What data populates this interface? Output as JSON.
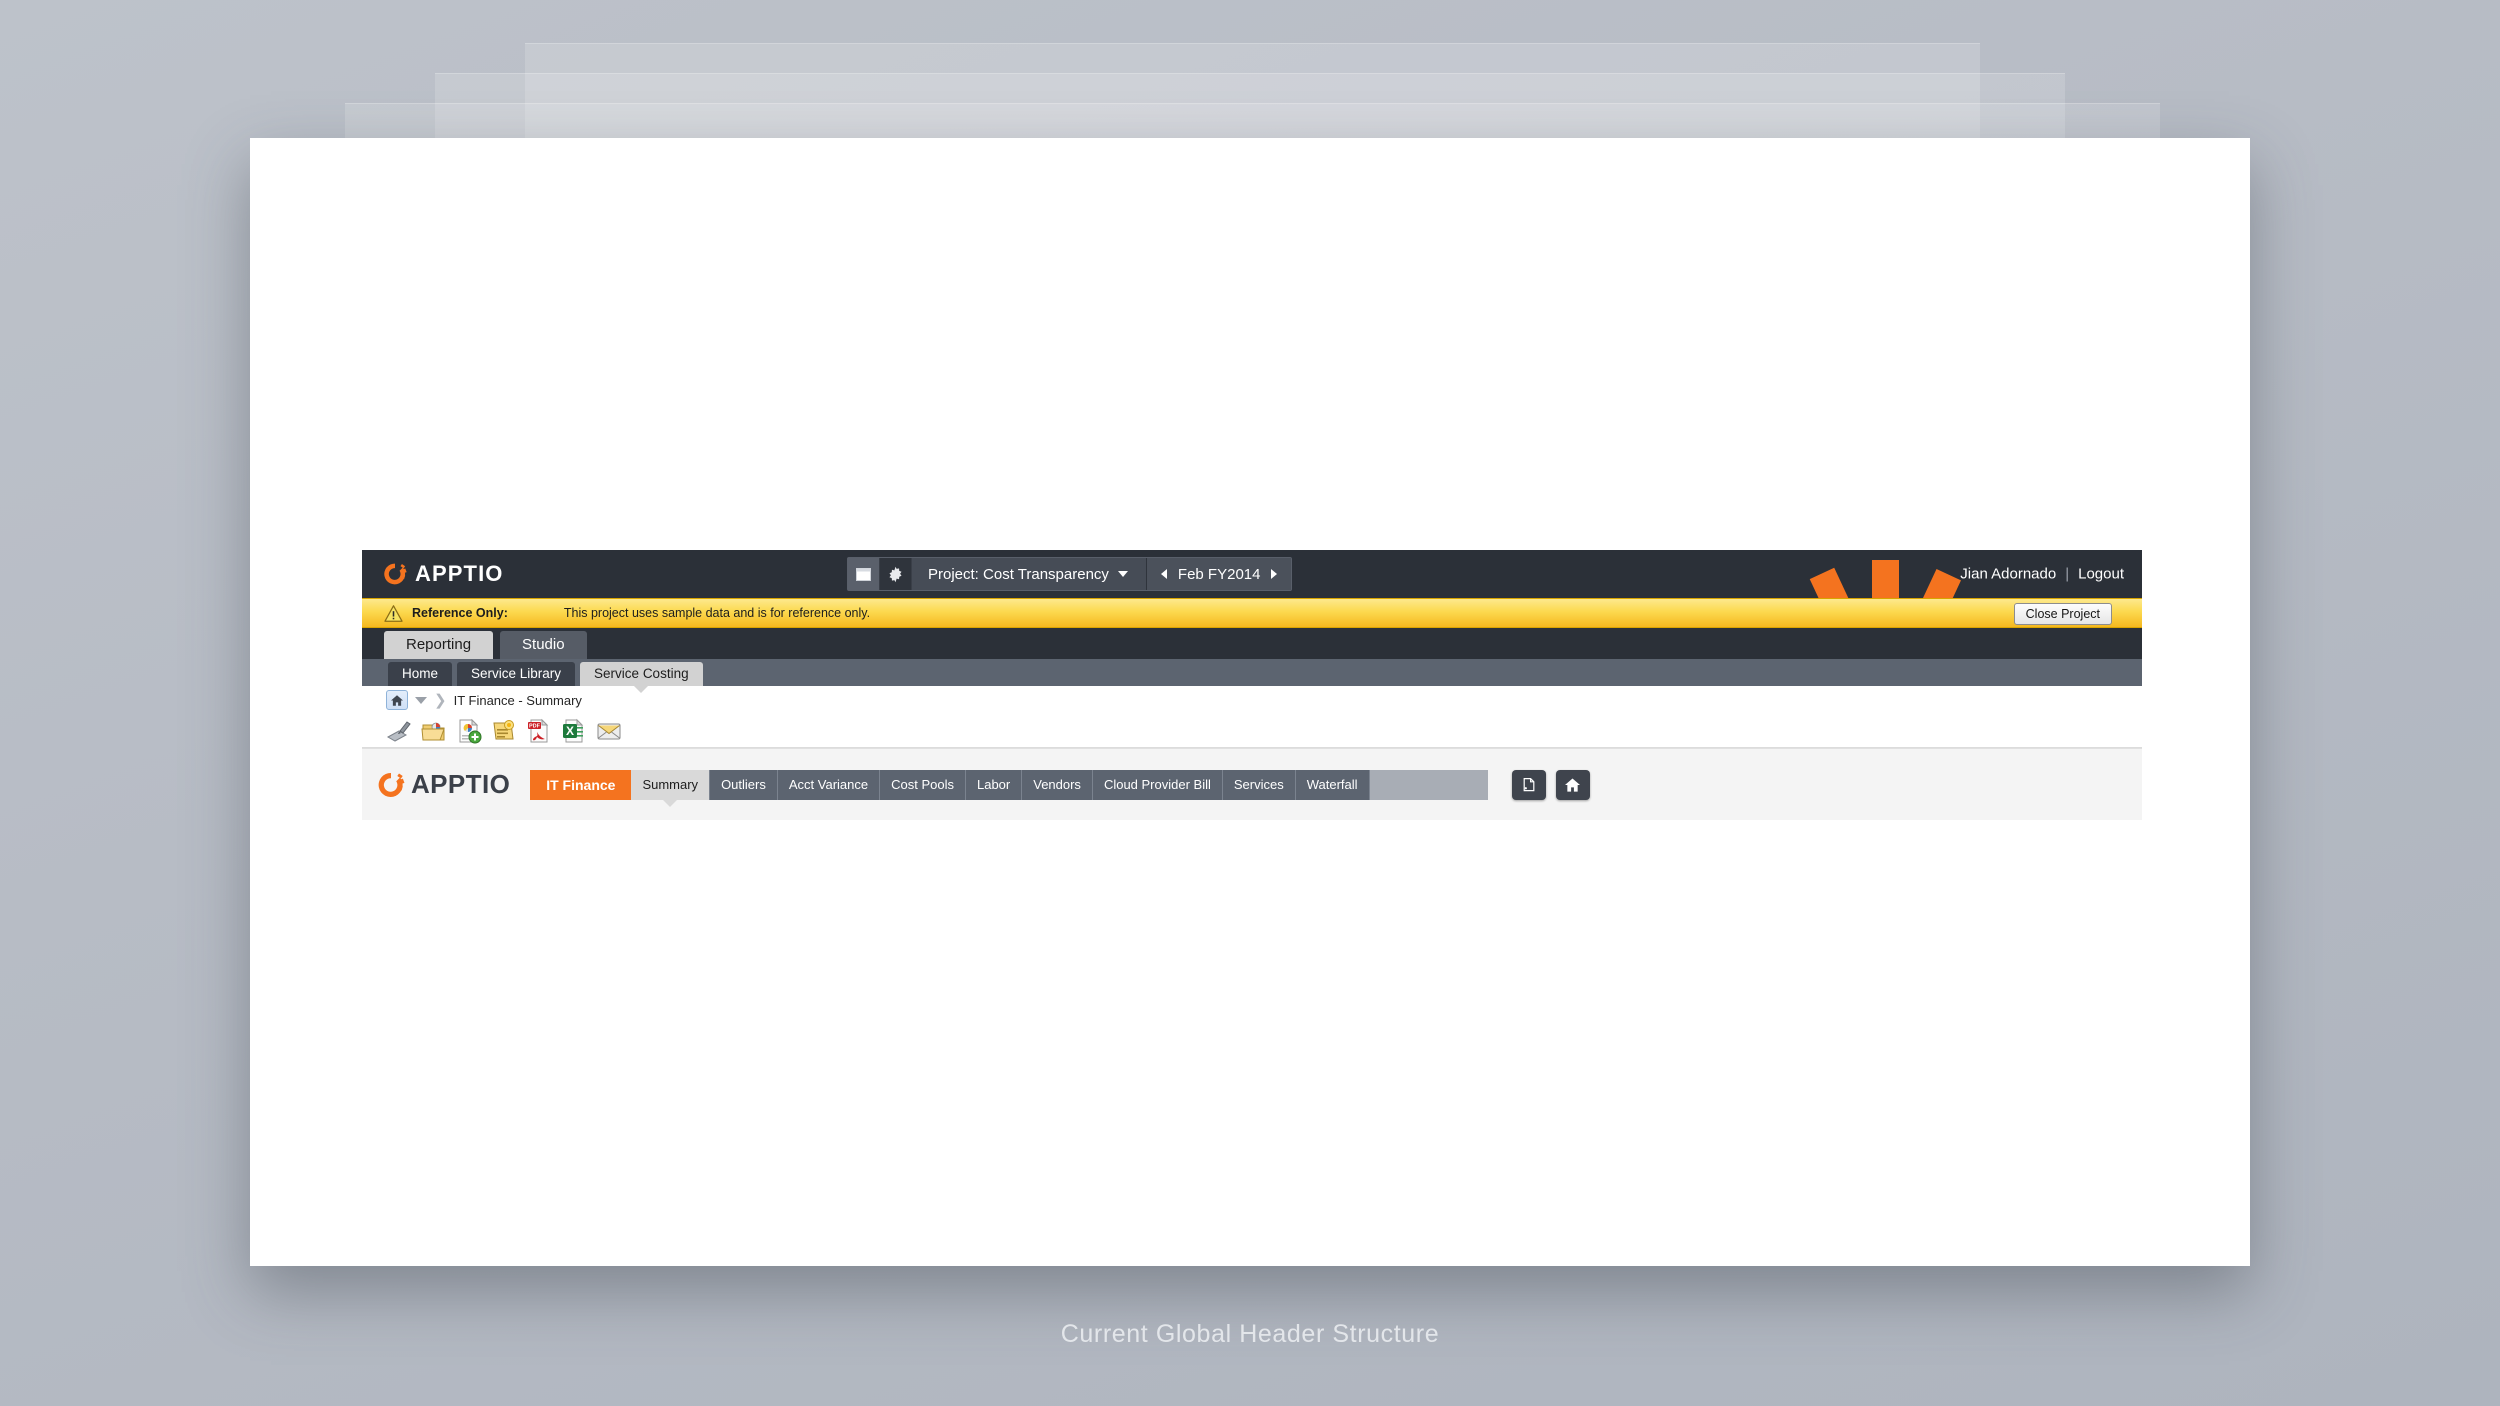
{
  "caption": "Current Global Header Structure",
  "global_header": {
    "logo_text": "APPTIO",
    "logo_icon": "apptio-gear-logo",
    "panel_toggle_icon": "window-panel-icon",
    "settings_icon": "gear-icon",
    "project_label": "Project: Cost Transparency",
    "project_caret_icon": "chevron-down-icon",
    "period_prev_icon": "arrow-left-icon",
    "period_label": "Feb FY2014",
    "period_next_icon": "arrow-right-icon",
    "user_name": "Jian Adornado",
    "separator": "|",
    "logout_label": "Logout",
    "watermark_icon": "orange-gear-watermark"
  },
  "reference_banner": {
    "warning_icon": "warning-triangle-icon",
    "label": "Reference Only:",
    "message": "This project uses sample data and is for reference only.",
    "close_button_label": "Close Project"
  },
  "primary_tabs": [
    {
      "label": "Reporting",
      "active": true
    },
    {
      "label": "Studio",
      "active": false
    }
  ],
  "secondary_tabs": [
    {
      "label": "Home",
      "active": false
    },
    {
      "label": "Service Library",
      "active": false
    },
    {
      "label": "Service Costing",
      "active": true
    }
  ],
  "breadcrumb": {
    "home_icon": "home-icon",
    "caret_icon": "caret-down-icon",
    "chevron_icon": "chevron-right-icon",
    "path": "IT Finance - Summary"
  },
  "icon_toolbar": [
    {
      "icon": "annotate-stylus-icon"
    },
    {
      "icon": "open-folder-report-icon"
    },
    {
      "icon": "new-report-icon"
    },
    {
      "icon": "edit-report-icon"
    },
    {
      "icon": "export-pdf-icon"
    },
    {
      "icon": "export-excel-icon"
    },
    {
      "icon": "email-report-icon"
    }
  ],
  "report_panel": {
    "logo_text": "APPTIO",
    "logo_icon": "apptio-gear-logo-dark",
    "brand_tab_label": "IT Finance",
    "tabs": [
      {
        "label": "Summary",
        "active": true
      },
      {
        "label": "Outliers",
        "active": false
      },
      {
        "label": "Acct Variance",
        "active": false
      },
      {
        "label": "Cost Pools",
        "active": false
      },
      {
        "label": "Labor",
        "active": false
      },
      {
        "label": "Vendors",
        "active": false
      },
      {
        "label": "Cloud Provider Bill",
        "active": false
      },
      {
        "label": "Services",
        "active": false
      },
      {
        "label": "Waterfall",
        "active": false
      }
    ],
    "buttons": [
      {
        "icon": "copy-page-icon"
      },
      {
        "icon": "home-icon"
      }
    ]
  },
  "colors": {
    "header_dark": "#2b3038",
    "subnav_slate": "#5c6470",
    "brand_orange": "#f4731f",
    "banner_yellow": "#fcd94f",
    "active_tab": "#d2d2d2"
  }
}
